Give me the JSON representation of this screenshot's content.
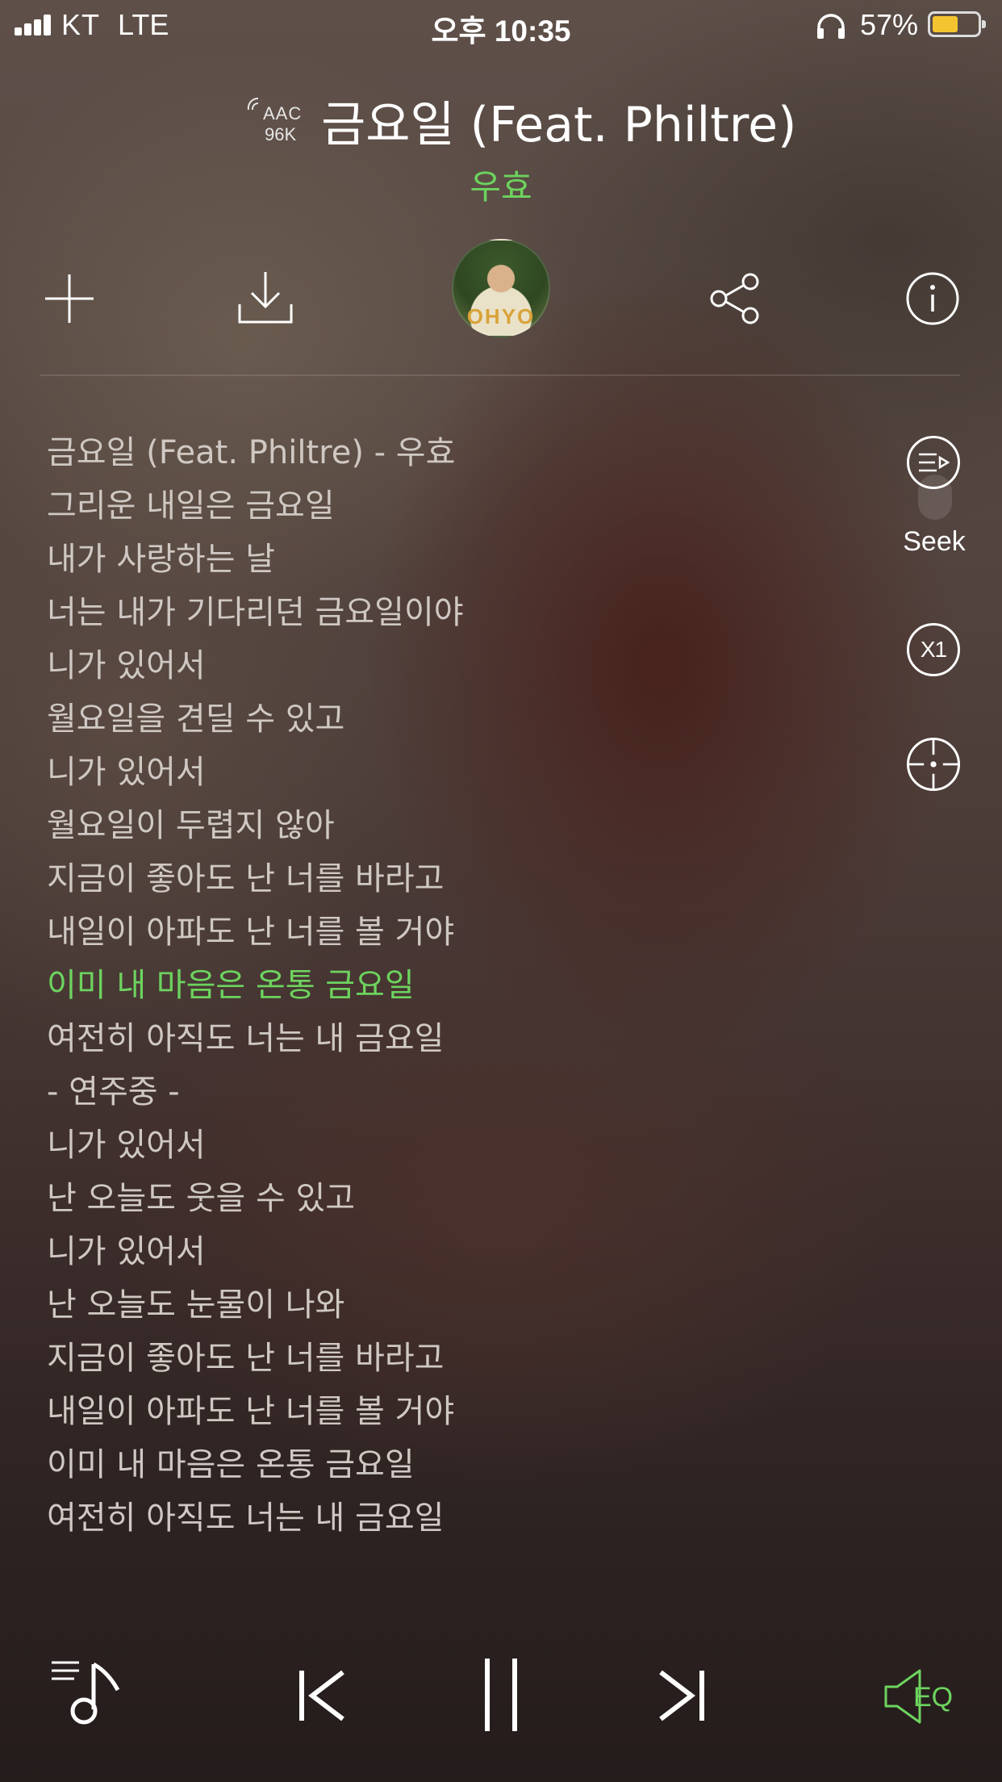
{
  "status_bar": {
    "carrier": "KT",
    "network": "LTE",
    "time": "오후 10:35",
    "battery_percent": "57%",
    "battery_level": 0.57,
    "icons": [
      "signal-icon",
      "headphone-icon",
      "battery-icon"
    ]
  },
  "track": {
    "codec": "AAC",
    "bitrate": "96K",
    "title": "금요일 (Feat. Philtre)",
    "artist": "우효",
    "album_art_text": "OHYO"
  },
  "actions": {
    "icons": [
      "add-icon",
      "download-icon",
      "album-art",
      "share-icon",
      "info-icon"
    ]
  },
  "lyrics": [
    "금요일 (Feat. Philtre) - 우효",
    "그리운 내일은 금요일",
    "내가 사랑하는 날",
    "너는 내가 기다리던 금요일이야",
    "니가 있어서",
    "월요일을 견딜 수 있고",
    "니가 있어서",
    "월요일이 두렵지 않아",
    "지금이 좋아도 난 너를 바라고",
    "내일이 아파도 난 너를 볼 거야",
    "이미 내 마음은 온통 금요일",
    "여전히 아직도 너는 내 금요일",
    " - 연주중 -",
    "니가 있어서",
    "난 오늘도 웃을 수 있고",
    "니가 있어서",
    "난 오늘도 눈물이 나와",
    "지금이 좋아도 난 너를 바라고",
    "내일이 아파도 난 너를 볼 거야",
    "이미 내 마음은 온통 금요일",
    "여전히 아직도 너는 내 금요일"
  ],
  "active_lyric_index": 10,
  "side_controls": {
    "seek_label": "Seek",
    "speed_label": "X1"
  },
  "player": {
    "eq_label": "EQ",
    "state": "playing"
  },
  "colors": {
    "accent": "#6dd35e",
    "lyric": "#cfc8c3",
    "battery": "#f4c430"
  }
}
